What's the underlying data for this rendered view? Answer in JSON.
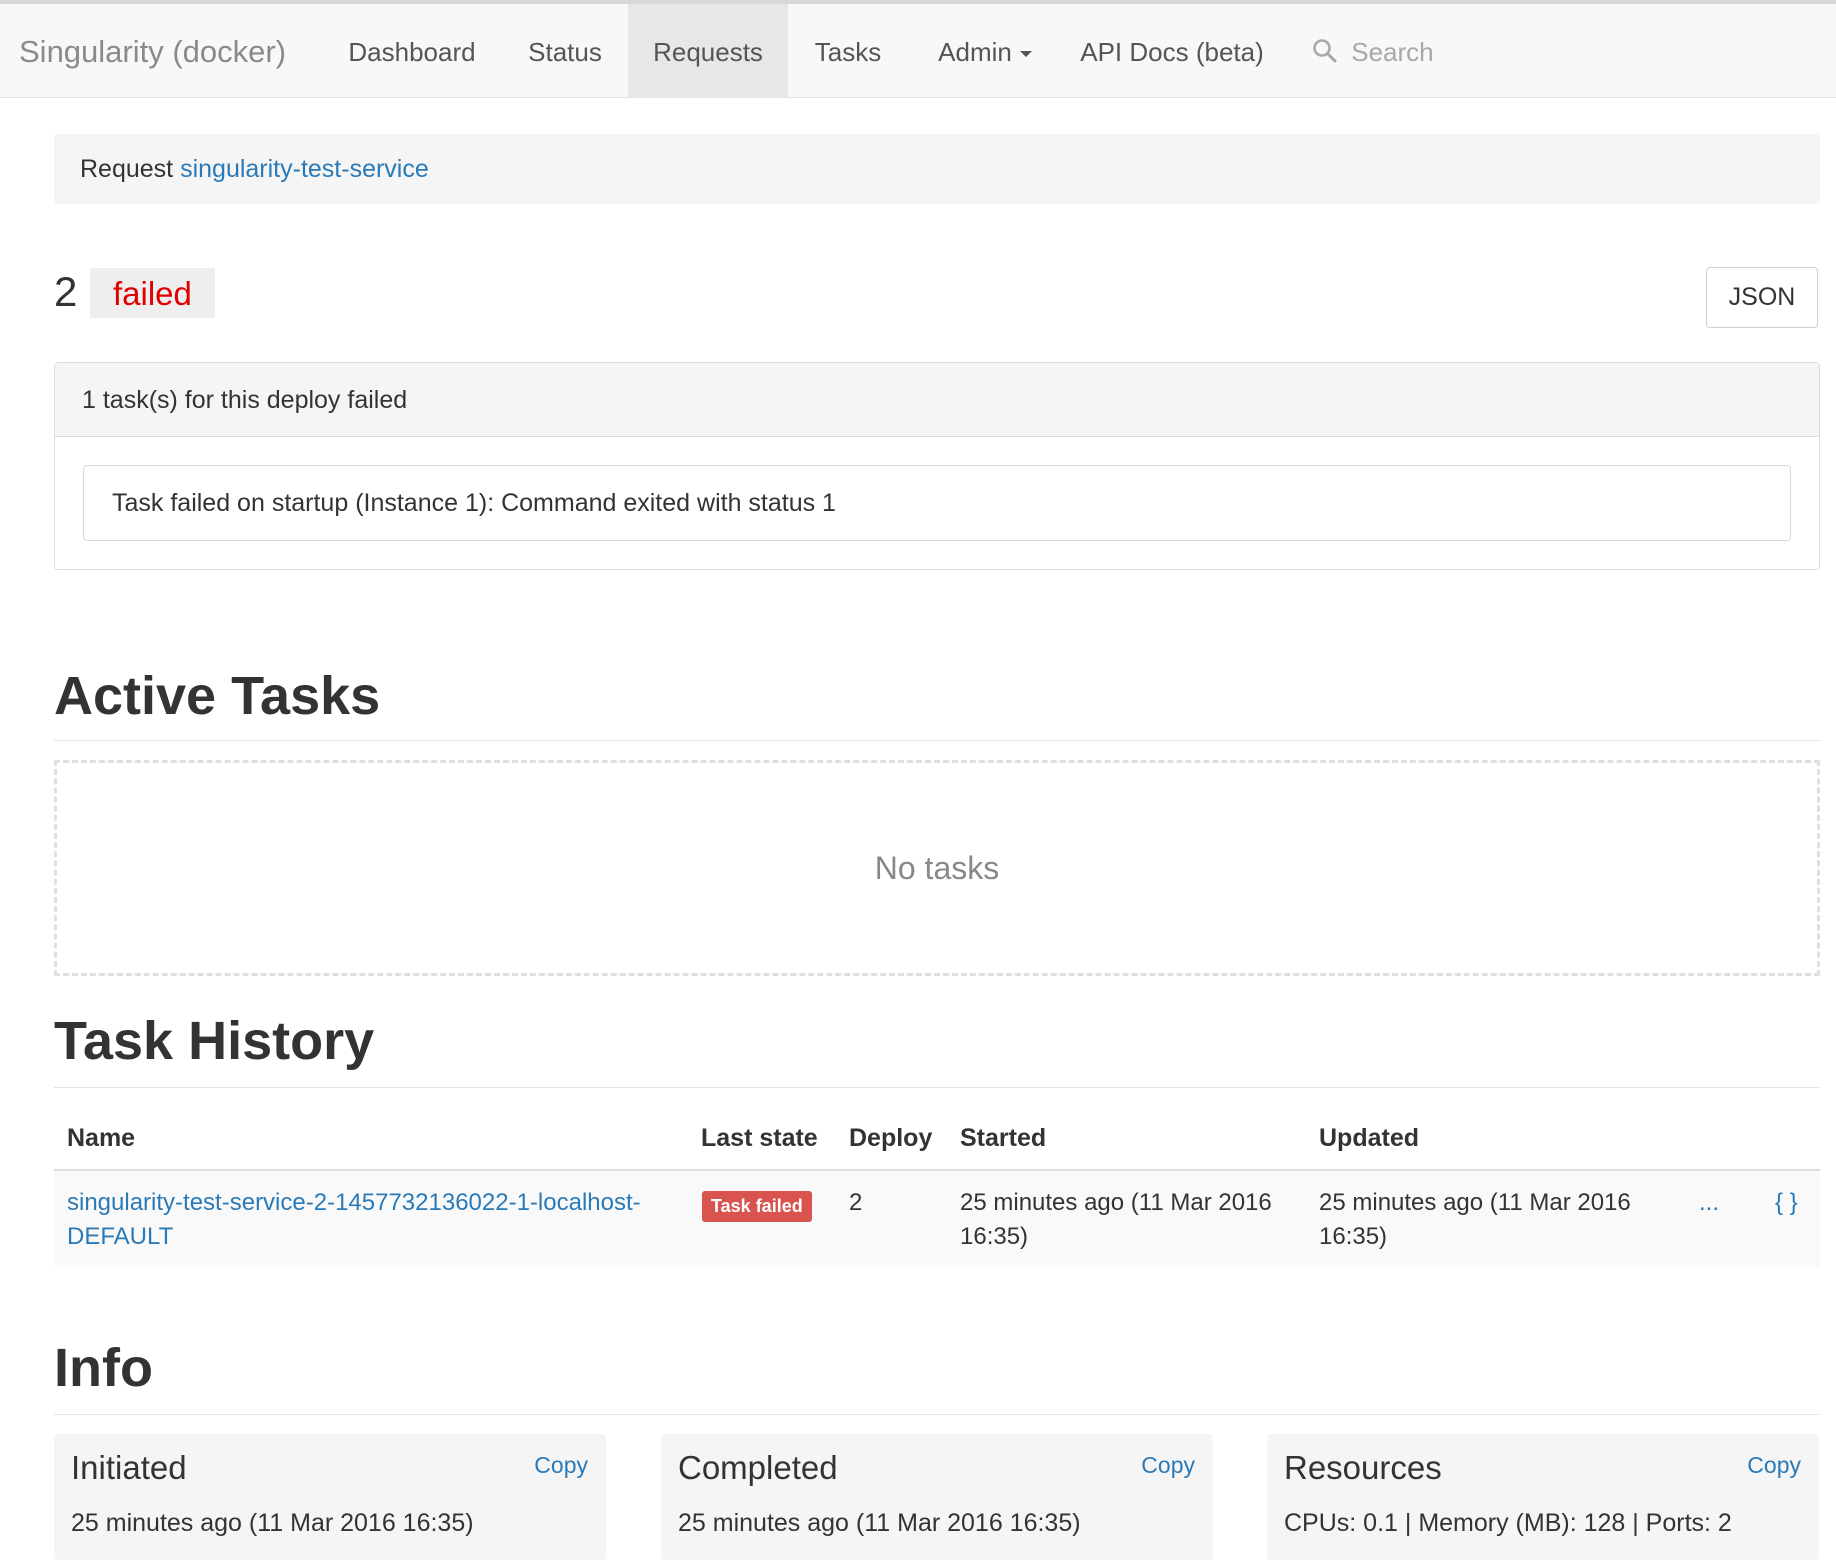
{
  "navbar": {
    "brand": "Singularity (docker)",
    "items": [
      {
        "label": "Dashboard"
      },
      {
        "label": "Status"
      },
      {
        "label": "Requests",
        "active": true
      },
      {
        "label": "Tasks"
      },
      {
        "label": "Admin",
        "has_caret": true
      },
      {
        "label": "API Docs (beta)"
      }
    ],
    "search_placeholder": "Search"
  },
  "breadcrumb": {
    "prefix": "Request",
    "request_link": "singularity-test-service"
  },
  "deploy": {
    "id": "2",
    "state": "failed",
    "json_button": "JSON"
  },
  "failure_panel": {
    "heading": "1 task(s) for this deploy failed",
    "message": "Task failed on startup (Instance 1): Command exited with status 1"
  },
  "active_tasks": {
    "title": "Active Tasks",
    "empty_text": "No tasks"
  },
  "task_history": {
    "title": "Task History",
    "columns": [
      "Name",
      "Last state",
      "Deploy",
      "Started",
      "Updated"
    ],
    "rows": [
      {
        "name_line1": "singularity-test-service-2-1457732136022-1-localhost-",
        "name_line2": "DEFAULT",
        "last_state": "Task failed",
        "deploy": "2",
        "started_line1": "25 minutes ago (11 Mar 2016",
        "started_line2": "16:35)",
        "updated_line1": "25 minutes ago (11 Mar 2016",
        "updated_line2": "16:35)",
        "more_action": "...",
        "json_action": "{ }"
      }
    ]
  },
  "info": {
    "title": "Info",
    "cards": [
      {
        "title": "Initiated",
        "copy": "Copy",
        "value": "25 minutes ago (11 Mar 2016 16:35)"
      },
      {
        "title": "Completed",
        "copy": "Copy",
        "value": "25 minutes ago (11 Mar 2016 16:35)"
      },
      {
        "title": "Resources",
        "copy": "Copy",
        "value": "CPUs: 0.1 | Memory (MB): 128 | Ports: 2"
      }
    ]
  },
  "colors": {
    "link": "#2a7ab8",
    "failed_text": "#e00000",
    "danger_label": "#d9534f",
    "navbar_bg": "#f8f8f8"
  }
}
